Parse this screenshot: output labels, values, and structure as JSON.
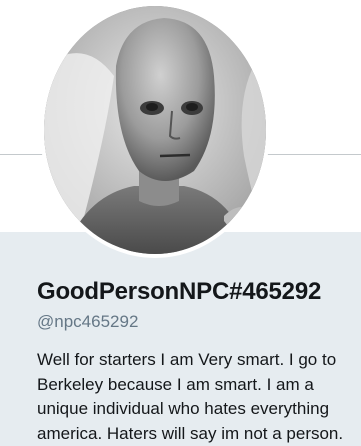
{
  "profile": {
    "display_name": "GoodPersonNPC#465292",
    "handle": "@npc465292",
    "bio": "Well for starters I am Very smart. I go to Berkeley because I am smart. I am a unique individual who hates everything america. Haters will say im not a person."
  },
  "colors": {
    "header_background": "#ffffff",
    "page_background": "#e6ecf0",
    "name_text": "#14171a",
    "handle_text": "#657786"
  },
  "icons": {
    "avatar": "npc-face-avatar"
  }
}
